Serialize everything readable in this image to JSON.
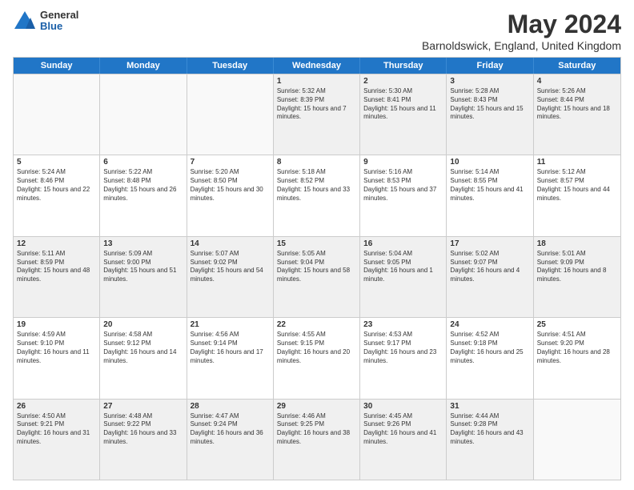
{
  "logo": {
    "general": "General",
    "blue": "Blue"
  },
  "title": "May 2024",
  "subtitle": "Barnoldswick, England, United Kingdom",
  "days": [
    "Sunday",
    "Monday",
    "Tuesday",
    "Wednesday",
    "Thursday",
    "Friday",
    "Saturday"
  ],
  "weeks": [
    [
      {
        "day": "",
        "empty": true
      },
      {
        "day": "",
        "empty": true
      },
      {
        "day": "",
        "empty": true
      },
      {
        "day": "1",
        "sunrise": "5:32 AM",
        "sunset": "8:39 PM",
        "daylight": "15 hours and 7 minutes."
      },
      {
        "day": "2",
        "sunrise": "5:30 AM",
        "sunset": "8:41 PM",
        "daylight": "15 hours and 11 minutes."
      },
      {
        "day": "3",
        "sunrise": "5:28 AM",
        "sunset": "8:43 PM",
        "daylight": "15 hours and 15 minutes."
      },
      {
        "day": "4",
        "sunrise": "5:26 AM",
        "sunset": "8:44 PM",
        "daylight": "15 hours and 18 minutes."
      }
    ],
    [
      {
        "day": "5",
        "sunrise": "5:24 AM",
        "sunset": "8:46 PM",
        "daylight": "15 hours and 22 minutes."
      },
      {
        "day": "6",
        "sunrise": "5:22 AM",
        "sunset": "8:48 PM",
        "daylight": "15 hours and 26 minutes."
      },
      {
        "day": "7",
        "sunrise": "5:20 AM",
        "sunset": "8:50 PM",
        "daylight": "15 hours and 30 minutes."
      },
      {
        "day": "8",
        "sunrise": "5:18 AM",
        "sunset": "8:52 PM",
        "daylight": "15 hours and 33 minutes."
      },
      {
        "day": "9",
        "sunrise": "5:16 AM",
        "sunset": "8:53 PM",
        "daylight": "15 hours and 37 minutes."
      },
      {
        "day": "10",
        "sunrise": "5:14 AM",
        "sunset": "8:55 PM",
        "daylight": "15 hours and 41 minutes."
      },
      {
        "day": "11",
        "sunrise": "5:12 AM",
        "sunset": "8:57 PM",
        "daylight": "15 hours and 44 minutes."
      }
    ],
    [
      {
        "day": "12",
        "sunrise": "5:11 AM",
        "sunset": "8:59 PM",
        "daylight": "15 hours and 48 minutes."
      },
      {
        "day": "13",
        "sunrise": "5:09 AM",
        "sunset": "9:00 PM",
        "daylight": "15 hours and 51 minutes."
      },
      {
        "day": "14",
        "sunrise": "5:07 AM",
        "sunset": "9:02 PM",
        "daylight": "15 hours and 54 minutes."
      },
      {
        "day": "15",
        "sunrise": "5:05 AM",
        "sunset": "9:04 PM",
        "daylight": "15 hours and 58 minutes."
      },
      {
        "day": "16",
        "sunrise": "5:04 AM",
        "sunset": "9:05 PM",
        "daylight": "16 hours and 1 minute."
      },
      {
        "day": "17",
        "sunrise": "5:02 AM",
        "sunset": "9:07 PM",
        "daylight": "16 hours and 4 minutes."
      },
      {
        "day": "18",
        "sunrise": "5:01 AM",
        "sunset": "9:09 PM",
        "daylight": "16 hours and 8 minutes."
      }
    ],
    [
      {
        "day": "19",
        "sunrise": "4:59 AM",
        "sunset": "9:10 PM",
        "daylight": "16 hours and 11 minutes."
      },
      {
        "day": "20",
        "sunrise": "4:58 AM",
        "sunset": "9:12 PM",
        "daylight": "16 hours and 14 minutes."
      },
      {
        "day": "21",
        "sunrise": "4:56 AM",
        "sunset": "9:14 PM",
        "daylight": "16 hours and 17 minutes."
      },
      {
        "day": "22",
        "sunrise": "4:55 AM",
        "sunset": "9:15 PM",
        "daylight": "16 hours and 20 minutes."
      },
      {
        "day": "23",
        "sunrise": "4:53 AM",
        "sunset": "9:17 PM",
        "daylight": "16 hours and 23 minutes."
      },
      {
        "day": "24",
        "sunrise": "4:52 AM",
        "sunset": "9:18 PM",
        "daylight": "16 hours and 25 minutes."
      },
      {
        "day": "25",
        "sunrise": "4:51 AM",
        "sunset": "9:20 PM",
        "daylight": "16 hours and 28 minutes."
      }
    ],
    [
      {
        "day": "26",
        "sunrise": "4:50 AM",
        "sunset": "9:21 PM",
        "daylight": "16 hours and 31 minutes."
      },
      {
        "day": "27",
        "sunrise": "4:48 AM",
        "sunset": "9:22 PM",
        "daylight": "16 hours and 33 minutes."
      },
      {
        "day": "28",
        "sunrise": "4:47 AM",
        "sunset": "9:24 PM",
        "daylight": "16 hours and 36 minutes."
      },
      {
        "day": "29",
        "sunrise": "4:46 AM",
        "sunset": "9:25 PM",
        "daylight": "16 hours and 38 minutes."
      },
      {
        "day": "30",
        "sunrise": "4:45 AM",
        "sunset": "9:26 PM",
        "daylight": "16 hours and 41 minutes."
      },
      {
        "day": "31",
        "sunrise": "4:44 AM",
        "sunset": "9:28 PM",
        "daylight": "16 hours and 43 minutes."
      },
      {
        "day": "",
        "empty": true
      }
    ]
  ]
}
